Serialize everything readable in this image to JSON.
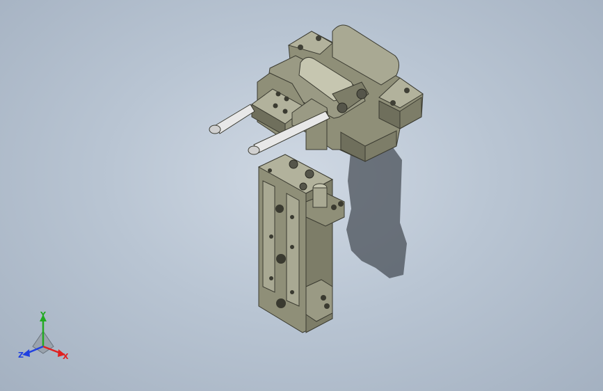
{
  "viewport": {
    "background_top": "#cfd8e3",
    "background_bottom": "#a4b1c1"
  },
  "model": {
    "body_color": "#8f8f78",
    "body_dark": "#6f6f5c",
    "body_light": "#b2b29c",
    "shadow_color": "#4a5058",
    "rod_color": "#e8e8e8"
  },
  "triad": {
    "x_label": "X",
    "y_label": "Y",
    "z_label": "Z",
    "x_color": "#e02020",
    "y_color": "#22aa22",
    "z_color": "#2040e0"
  }
}
